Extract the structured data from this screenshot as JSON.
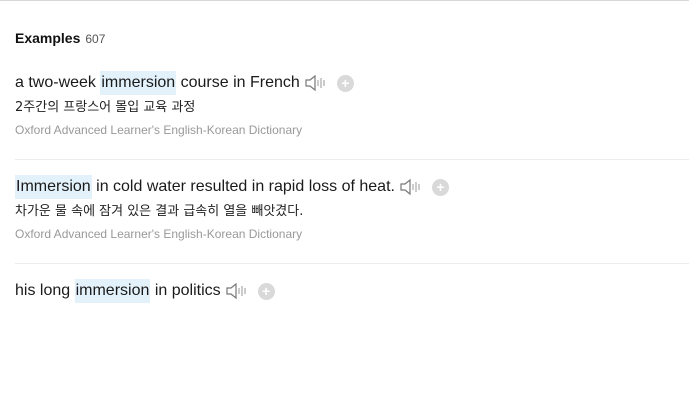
{
  "section": {
    "title": "Examples",
    "count": "607"
  },
  "examples": [
    {
      "before": "a two-week ",
      "highlight": "immersion",
      "after": " course in French",
      "translation": "2주간의 프랑스어 몰입 교육 과정",
      "source": "Oxford Advanced Learner's English-Korean Dictionary"
    },
    {
      "before": "",
      "highlight": "Immersion",
      "after": " in cold water resulted in rapid loss of heat.",
      "translation": "차가운 물 속에 잠겨 있은 결과 급속히 열을 빼앗겼다.",
      "source": "Oxford Advanced Learner's English-Korean Dictionary"
    },
    {
      "before": "his long ",
      "highlight": "immersion",
      "after": " in politics"
    }
  ],
  "icons": {
    "audio": "speaker-icon",
    "add": "plus-icon"
  },
  "colors": {
    "highlight": "#e3f1fb",
    "source_text": "#999999",
    "plus_button": "#d9d9d9"
  }
}
